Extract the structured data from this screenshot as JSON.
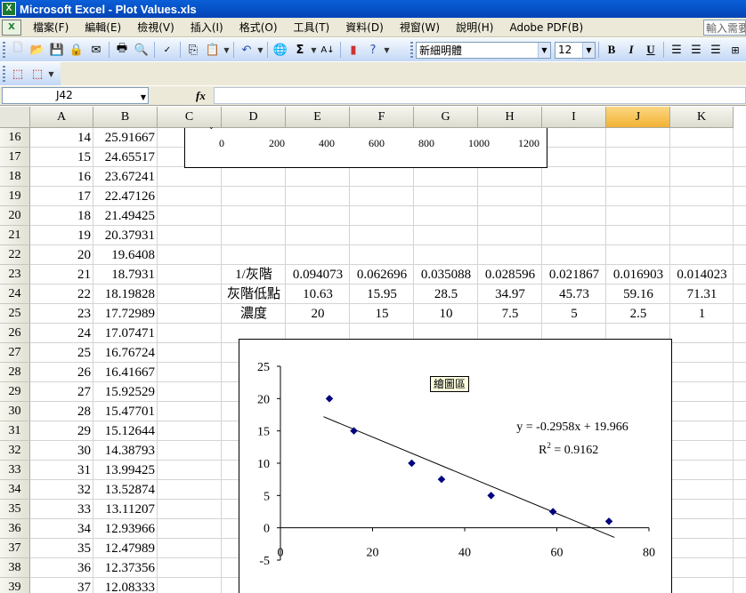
{
  "window": {
    "title": "Microsoft Excel - Plot Values.xls",
    "app_icon": "excel-icon"
  },
  "menu": {
    "items": [
      "檔案(F)",
      "編輯(E)",
      "檢視(V)",
      "插入(I)",
      "格式(O)",
      "工具(T)",
      "資料(D)",
      "視窗(W)",
      "說明(H)",
      "Adobe PDF(B)"
    ],
    "help_box": "輸入需要"
  },
  "format_toolbar": {
    "font_name": "新細明體",
    "font_size": "12",
    "bold": "B",
    "italic": "I",
    "underline": "U"
  },
  "formula_bar": {
    "name_box": "J42",
    "fx": "fx",
    "value": ""
  },
  "sheet": {
    "columns": [
      "A",
      "B",
      "C",
      "D",
      "E",
      "F",
      "G",
      "H",
      "I",
      "J",
      "K"
    ],
    "selected_column": "J",
    "rows": [
      {
        "n": "16",
        "a": "14",
        "b": "25.91667"
      },
      {
        "n": "17",
        "a": "15",
        "b": "24.65517"
      },
      {
        "n": "18",
        "a": "16",
        "b": "23.67241"
      },
      {
        "n": "19",
        "a": "17",
        "b": "22.47126"
      },
      {
        "n": "20",
        "a": "18",
        "b": "21.49425"
      },
      {
        "n": "21",
        "a": "19",
        "b": "20.37931"
      },
      {
        "n": "22",
        "a": "20",
        "b": "19.6408"
      },
      {
        "n": "23",
        "a": "21",
        "b": "18.7931"
      },
      {
        "n": "24",
        "a": "22",
        "b": "18.19828"
      },
      {
        "n": "25",
        "a": "23",
        "b": "17.72989"
      },
      {
        "n": "26",
        "a": "24",
        "b": "17.07471"
      },
      {
        "n": "27",
        "a": "25",
        "b": "16.76724"
      },
      {
        "n": "28",
        "a": "26",
        "b": "16.41667"
      },
      {
        "n": "29",
        "a": "27",
        "b": "15.92529"
      },
      {
        "n": "30",
        "a": "28",
        "b": "15.47701"
      },
      {
        "n": "31",
        "a": "29",
        "b": "15.12644"
      },
      {
        "n": "32",
        "a": "30",
        "b": "14.38793"
      },
      {
        "n": "33",
        "a": "31",
        "b": "13.99425"
      },
      {
        "n": "34",
        "a": "32",
        "b": "13.52874"
      },
      {
        "n": "35",
        "a": "33",
        "b": "13.11207"
      },
      {
        "n": "36",
        "a": "34",
        "b": "12.93966"
      },
      {
        "n": "37",
        "a": "35",
        "b": "12.47989"
      },
      {
        "n": "38",
        "a": "36",
        "b": "12.37356"
      },
      {
        "n": "39",
        "a": "37",
        "b": "12.08333"
      }
    ],
    "table": {
      "row23": {
        "label": "1/灰階",
        "values": [
          "0.094073",
          "0.062696",
          "0.035088",
          "0.028596",
          "0.021867",
          "0.016903",
          "0.014023"
        ]
      },
      "row24": {
        "label": "灰階低點",
        "values": [
          "10.63",
          "15.95",
          "28.5",
          "34.97",
          "45.73",
          "59.16",
          "71.31"
        ]
      },
      "row25": {
        "label": "濃度",
        "values": [
          "20",
          "15",
          "10",
          "7.5",
          "5",
          "2.5",
          "1"
        ]
      }
    }
  },
  "top_chart_axis": {
    "ticks": [
      "0",
      "200",
      "400",
      "600",
      "800",
      "1000",
      "1200"
    ]
  },
  "chart_data": {
    "type": "scatter",
    "x": [
      10.63,
      15.95,
      28.5,
      34.97,
      45.73,
      59.16,
      71.31
    ],
    "y": [
      20,
      15,
      10,
      7.5,
      5,
      2.5,
      1
    ],
    "xlim": [
      0,
      80
    ],
    "ylim": [
      -5,
      25
    ],
    "x_ticks": [
      "0",
      "20",
      "40",
      "60",
      "80"
    ],
    "y_ticks": [
      "25",
      "20",
      "15",
      "10",
      "5",
      "0",
      "-5"
    ],
    "trendline": {
      "slope": -0.2958,
      "intercept": 19.966
    },
    "equation": "y = -0.2958x + 19.966",
    "r2_label": "R",
    "r2_sup": "2",
    "r2_value": " = 0.9162",
    "tooltip": "繪圖區",
    "marker_color": "#00007f"
  }
}
